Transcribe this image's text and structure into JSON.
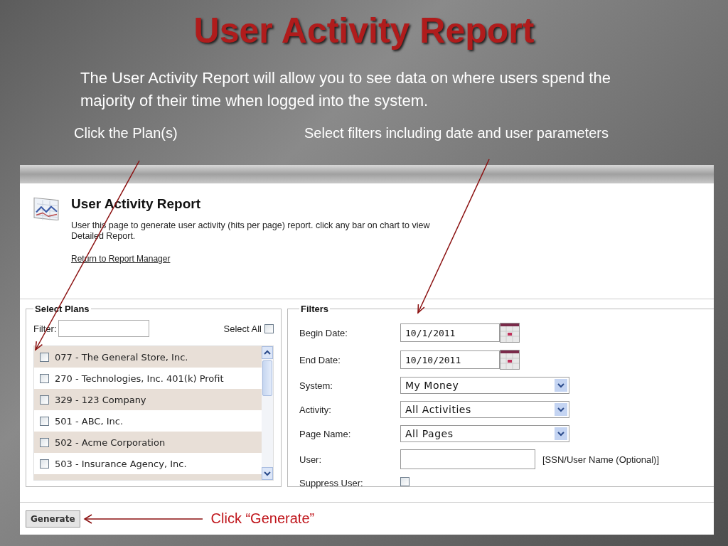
{
  "slide": {
    "title": "User Activity Report",
    "intro": "The User Activity Report will allow you to see data on where users spend the majority of their time when logged into the system.",
    "callouts": [
      "Click the Plan(s)",
      "Select filters including date and user parameters"
    ],
    "generate_callout": "Click “Generate”"
  },
  "report": {
    "title": "User Activity Report",
    "description": "User this page to generate user activity (hits per page) report. click any bar on chart to view Detailed Report.",
    "link": "Return to Report Manager"
  },
  "plans": {
    "title": "Select Plans",
    "filter_label": "Filter:",
    "select_all": {
      "label": "Select All",
      "checked": false
    },
    "items": [
      {
        "label": "077 - The  General Store, Inc.",
        "checked": false
      },
      {
        "label": "270 - Technologies, Inc. 401(k) Profit",
        "checked": false
      },
      {
        "label": "329 - 123 Company",
        "checked": false
      },
      {
        "label": "501 - ABC, Inc.",
        "checked": false
      },
      {
        "label": "502 - Acme  Corporation",
        "checked": false
      },
      {
        "label": "503 - Insurance Agency, Inc.",
        "checked": false
      }
    ]
  },
  "filters": {
    "title": "Filters",
    "fields": [
      {
        "kind": "date",
        "label": "Begin Date:",
        "value": "10/1/2011"
      },
      {
        "kind": "date",
        "label": "End Date:",
        "value": "10/10/2011"
      },
      {
        "kind": "select",
        "label": "System:",
        "value": "My Money"
      },
      {
        "kind": "select",
        "label": "Activity:",
        "value": "All Activities"
      },
      {
        "kind": "select",
        "label": "Page Name:",
        "value": "All Pages"
      },
      {
        "kind": "text",
        "label": "User:",
        "hint": "[SSN/User Name (Optional)]"
      },
      {
        "kind": "checkbox",
        "label": "Suppress User:",
        "checked": false
      }
    ]
  },
  "generate_button": "Generate"
}
